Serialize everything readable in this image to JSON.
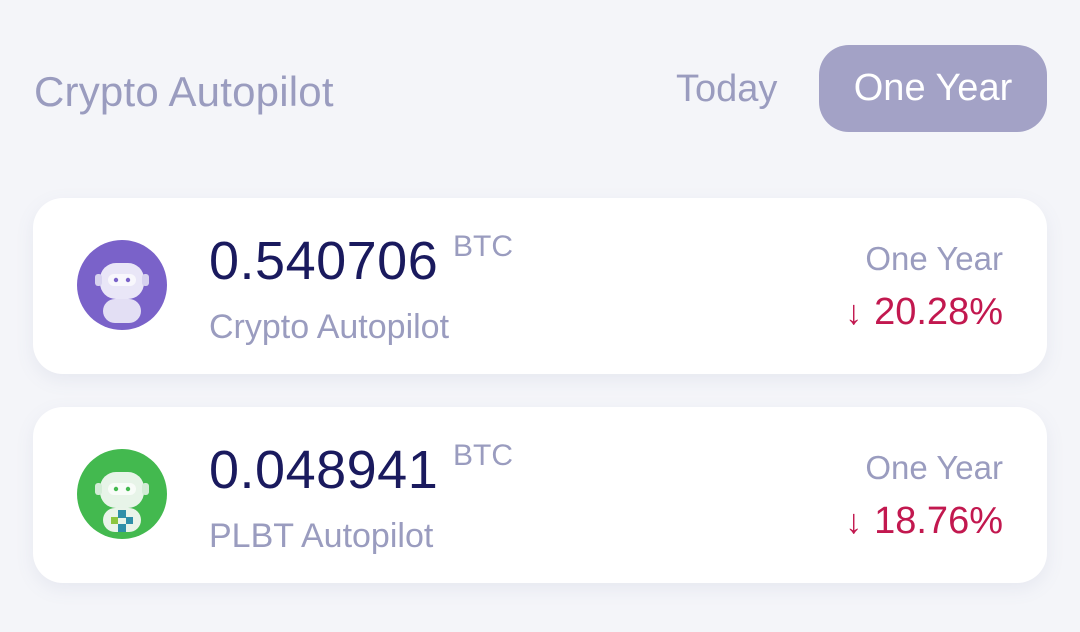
{
  "header": {
    "title": "Crypto Autopilot",
    "tabs": [
      {
        "label": "Today",
        "active": false
      },
      {
        "label": "One Year",
        "active": true
      }
    ]
  },
  "colors": {
    "background": "#f4f5f9",
    "card": "#ffffff",
    "muted_text": "#9a9cbf",
    "amount_text": "#1a1a5e",
    "active_tab": "#a3a2c6",
    "negative_change": "#c2184f",
    "crypto_avatar": "#7a62c9",
    "plbt_avatar": "#43b94f"
  },
  "cards": [
    {
      "amount": "0.540706",
      "unit": "BTC",
      "name": "Crypto Autopilot",
      "period": "One Year",
      "change_icon": "down-arrow-icon",
      "change": "20.28%"
    },
    {
      "amount": "0.048941",
      "unit": "BTC",
      "name": "PLBT Autopilot",
      "period": "One Year",
      "change_icon": "down-arrow-icon",
      "change": "18.76%"
    }
  ]
}
